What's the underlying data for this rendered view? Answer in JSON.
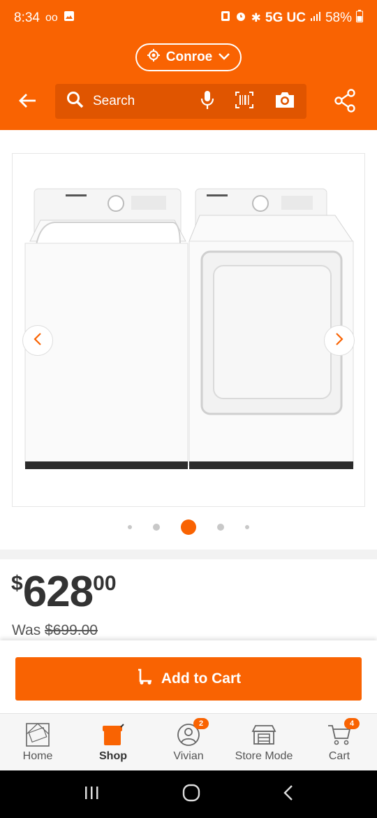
{
  "status_bar": {
    "time": "8:34",
    "network": "5G UC",
    "battery": "58%"
  },
  "header": {
    "store_name": "Conroe",
    "search_placeholder": "Search"
  },
  "gallery": {
    "image_count": 5,
    "active_index": 2
  },
  "price": {
    "currency": "$",
    "dollars": "628",
    "cents": "00",
    "was_label": "Was",
    "was_price": "$699.00"
  },
  "actions": {
    "add_to_cart_label": "Add to Cart"
  },
  "tabs": [
    {
      "label": "Home",
      "icon": "home-depot-logo-icon",
      "active": false
    },
    {
      "label": "Shop",
      "icon": "paint-bucket-icon",
      "active": true
    },
    {
      "label": "Vivian",
      "icon": "user-icon",
      "active": false,
      "badge": "2"
    },
    {
      "label": "Store Mode",
      "icon": "store-icon",
      "active": false
    },
    {
      "label": "Cart",
      "icon": "cart-icon",
      "active": false,
      "badge": "4"
    }
  ],
  "colors": {
    "brand": "#f96302",
    "search_bg": "#e05500",
    "text": "#333333"
  }
}
